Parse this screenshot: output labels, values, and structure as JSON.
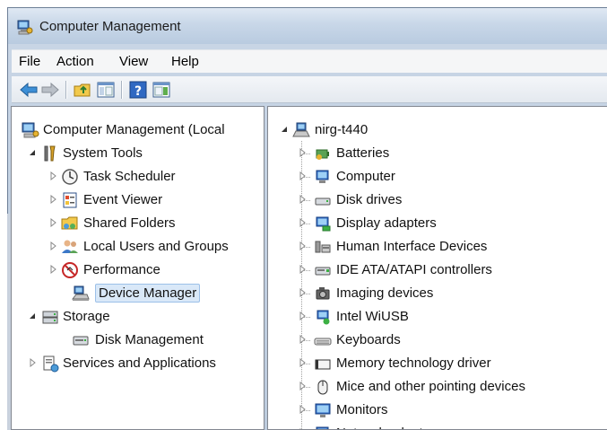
{
  "window": {
    "title": "Computer Management"
  },
  "menu": [
    "File",
    "Action",
    "View",
    "Help"
  ],
  "toolbar": [
    "back-arrow",
    "forward-arrow",
    "up-folder",
    "show-hide-console-tree",
    "help",
    "show-hide-action-pane"
  ],
  "left_tree": [
    {
      "label": "Computer Management (Local",
      "icon": "computer-management-icon",
      "expander": "none",
      "level": 0
    },
    {
      "label": "System Tools",
      "icon": "system-tools-icon",
      "expander": "expanded",
      "level": 1
    },
    {
      "label": "Task Scheduler",
      "icon": "task-scheduler-icon",
      "expander": "collapsed",
      "level": 2
    },
    {
      "label": "Event Viewer",
      "icon": "event-viewer-icon",
      "expander": "collapsed",
      "level": 2
    },
    {
      "label": "Shared Folders",
      "icon": "shared-folders-icon",
      "expander": "collapsed",
      "level": 2
    },
    {
      "label": "Local Users and Groups",
      "icon": "local-users-icon",
      "expander": "collapsed",
      "level": 2
    },
    {
      "label": "Performance",
      "icon": "performance-icon",
      "expander": "collapsed",
      "level": 2
    },
    {
      "label": "Device Manager",
      "icon": "device-manager-icon",
      "expander": "none",
      "level": 2,
      "selected": true
    },
    {
      "label": "Storage",
      "icon": "storage-icon",
      "expander": "expanded",
      "level": 1
    },
    {
      "label": "Disk Management",
      "icon": "disk-management-icon",
      "expander": "none",
      "level": 2
    },
    {
      "label": "Services and Applications",
      "icon": "services-applications-icon",
      "expander": "collapsed",
      "level": 1
    }
  ],
  "device_tree": {
    "root": "nirg-t440",
    "items": [
      {
        "label": "Batteries",
        "icon": "battery-icon"
      },
      {
        "label": "Computer",
        "icon": "computer-icon"
      },
      {
        "label": "Disk drives",
        "icon": "disk-drive-icon"
      },
      {
        "label": "Display adapters",
        "icon": "display-adapter-icon"
      },
      {
        "label": "Human Interface Devices",
        "icon": "hid-icon"
      },
      {
        "label": "IDE ATA/ATAPI controllers",
        "icon": "ide-controller-icon"
      },
      {
        "label": "Imaging devices",
        "icon": "camera-icon"
      },
      {
        "label": "Intel WiUSB",
        "icon": "wiusb-icon"
      },
      {
        "label": "Keyboards",
        "icon": "keyboard-icon"
      },
      {
        "label": "Memory technology driver",
        "icon": "memory-icon"
      },
      {
        "label": "Mice and other pointing devices",
        "icon": "mouse-icon"
      },
      {
        "label": "Monitors",
        "icon": "monitor-icon"
      },
      {
        "label": "Network adapters",
        "icon": "network-adapter-icon"
      }
    ]
  },
  "colors": {
    "selection": "#d9e8f8",
    "selection_border": "#9cc0e8",
    "chrome": "#c8d7e8"
  }
}
